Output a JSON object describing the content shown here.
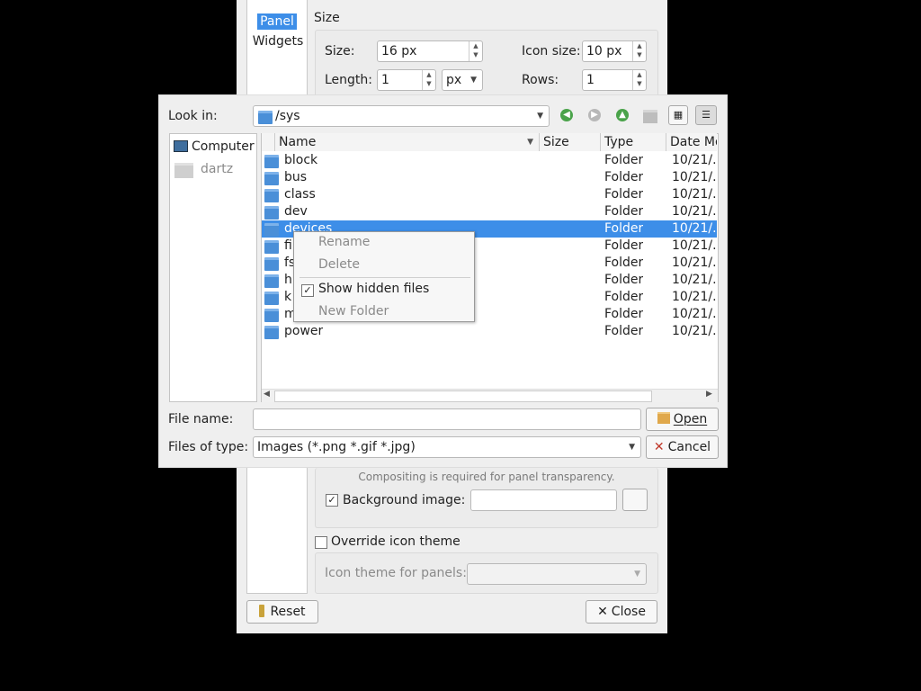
{
  "bg_panel": {
    "side_tabs": [
      "Panel",
      "Widgets"
    ],
    "size_group_title": "Size",
    "size_label": "Size:",
    "size_value": "16 px",
    "icon_size_label": "Icon size:",
    "icon_size_value": "10 px",
    "length_label": "Length:",
    "length_value": "1",
    "length_unit": "px",
    "rows_label": "Rows:",
    "rows_value": "1",
    "compositing_note": "Compositing is required for panel transparency.",
    "bg_image_label": "Background image:",
    "override_icon_label": "Override icon theme",
    "icon_theme_label": "Icon theme for panels:",
    "reset_label": "Reset",
    "close_label": "Close"
  },
  "file_dialog": {
    "look_in_label": "Look in:",
    "look_in_path": "/sys",
    "places": [
      "Computer",
      "dartz"
    ],
    "columns": [
      "Name",
      "Size",
      "Type",
      "Date Mo"
    ],
    "files": [
      {
        "name": "block",
        "type": "Folder",
        "date": "10/21/."
      },
      {
        "name": "bus",
        "type": "Folder",
        "date": "10/21/."
      },
      {
        "name": "class",
        "type": "Folder",
        "date": "10/21/."
      },
      {
        "name": "dev",
        "type": "Folder",
        "date": "10/21/."
      },
      {
        "name": "devices",
        "type": "Folder",
        "date": "10/21/."
      },
      {
        "name": "fi",
        "type": "Folder",
        "date": "10/21/."
      },
      {
        "name": "fs",
        "type": "Folder",
        "date": "10/21/."
      },
      {
        "name": "h",
        "type": "Folder",
        "date": "10/21/."
      },
      {
        "name": "k",
        "type": "Folder",
        "date": "10/21/."
      },
      {
        "name": "m",
        "type": "Folder",
        "date": "10/21/."
      },
      {
        "name": "power",
        "type": "Folder",
        "date": "10/21/."
      }
    ],
    "file_name_label": "File name:",
    "file_name_value": "",
    "files_of_type_label": "Files of type:",
    "files_of_type_value": "Images (*.png *.gif *.jpg)",
    "open_label": "Open",
    "cancel_label": "Cancel"
  },
  "context_menu": {
    "rename": "Rename",
    "delete": "Delete",
    "show_hidden": "Show hidden files",
    "new_folder": "New Folder"
  },
  "colors": {
    "selection": "#3d8ee8",
    "window_bg": "#efefef"
  }
}
